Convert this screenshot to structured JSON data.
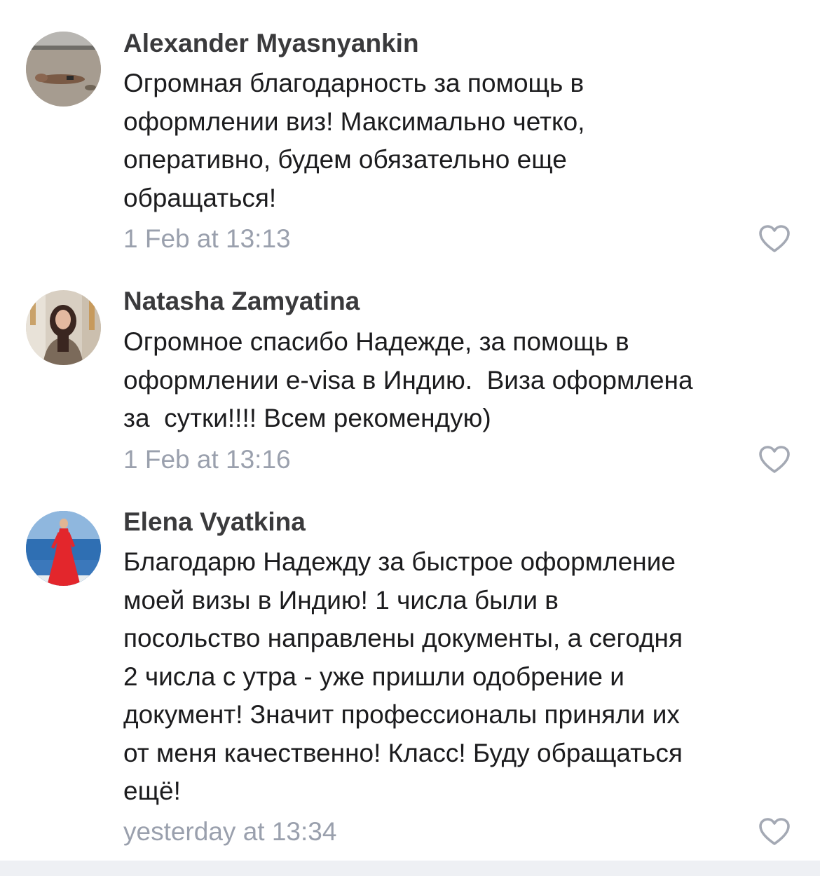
{
  "comments": [
    {
      "author": "Alexander Myasnyankin",
      "avatar_icon": "avatar-beach-photo",
      "lines": [
        "Огромная благодарность за помощь в",
        "оформлении виз! Максимально четко,",
        "оперативно, будем обязательно еще",
        "обращаться!"
      ],
      "time": "1 Feb at 13:13",
      "like_icon": "heart-outline-icon"
    },
    {
      "author": "Natasha Zamyatina",
      "avatar_icon": "avatar-woman-photo",
      "lines": [
        "Огромное спасибо Надежде, за помощь в",
        "оформлении e-visa в Индию.  Виза оформлена",
        "за  сутки!!!! Всем рекомендую)"
      ],
      "time": "1 Feb at 13:16",
      "like_icon": "heart-outline-icon"
    },
    {
      "author": "Elena Vyatkina",
      "avatar_icon": "avatar-red-dress-photo",
      "lines": [
        "Благодарю Надежду за быстрое оформление",
        "моей визы в Индию! 1 числа были в",
        "посольство направлены документы, а сегодня",
        "2 числа с утра - уже пришли одобрение и",
        "документ! Значит профессионалы приняли их",
        "от меня качественно! Класс! Буду обращаться",
        "ещё!"
      ],
      "time": "yesterday at 13:34",
      "like_icon": "heart-outline-icon"
    }
  ],
  "colors": {
    "author": "#3a3a3c",
    "text": "#1c1c1e",
    "time": "#9aa0ad",
    "heart": "#a4a9b4",
    "bottom_bar": "#eef0f4"
  }
}
